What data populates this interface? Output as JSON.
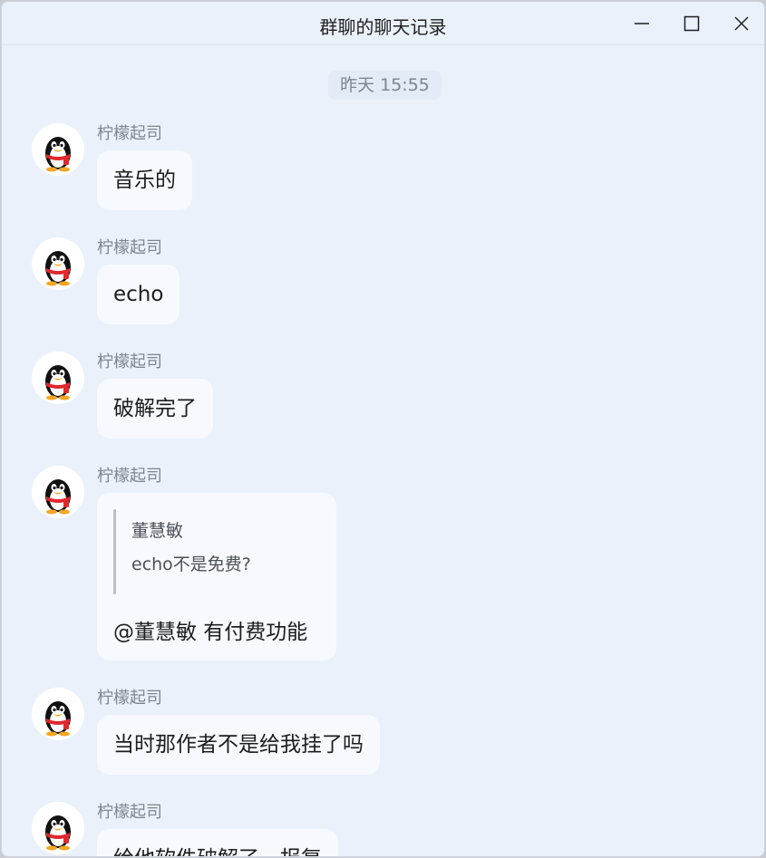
{
  "window": {
    "title": "群聊的聊天记录"
  },
  "chat": {
    "timestamp": "昨天 15:55",
    "messages": [
      {
        "sender": "柠檬起司",
        "text": "音乐的"
      },
      {
        "sender": "柠檬起司",
        "text": "echo"
      },
      {
        "sender": "柠檬起司",
        "text": "破解完了"
      },
      {
        "sender": "柠檬起司",
        "quote": {
          "author": "董慧敏",
          "text": "echo不是免费?"
        },
        "text": "@董慧敏 有付费功能"
      },
      {
        "sender": "柠檬起司",
        "text": "当时那作者不是给我挂了吗"
      },
      {
        "sender": "柠檬起司",
        "text": "给他软件破解了，报复"
      }
    ]
  },
  "colors": {
    "background": "#eaf1fb",
    "bubble": "#f7f9fe",
    "sender_name": "#7f858d"
  },
  "icons": {
    "avatar": "qq-penguin-icon",
    "minimize": "minimize-icon",
    "maximize": "maximize-icon",
    "close": "close-icon"
  }
}
